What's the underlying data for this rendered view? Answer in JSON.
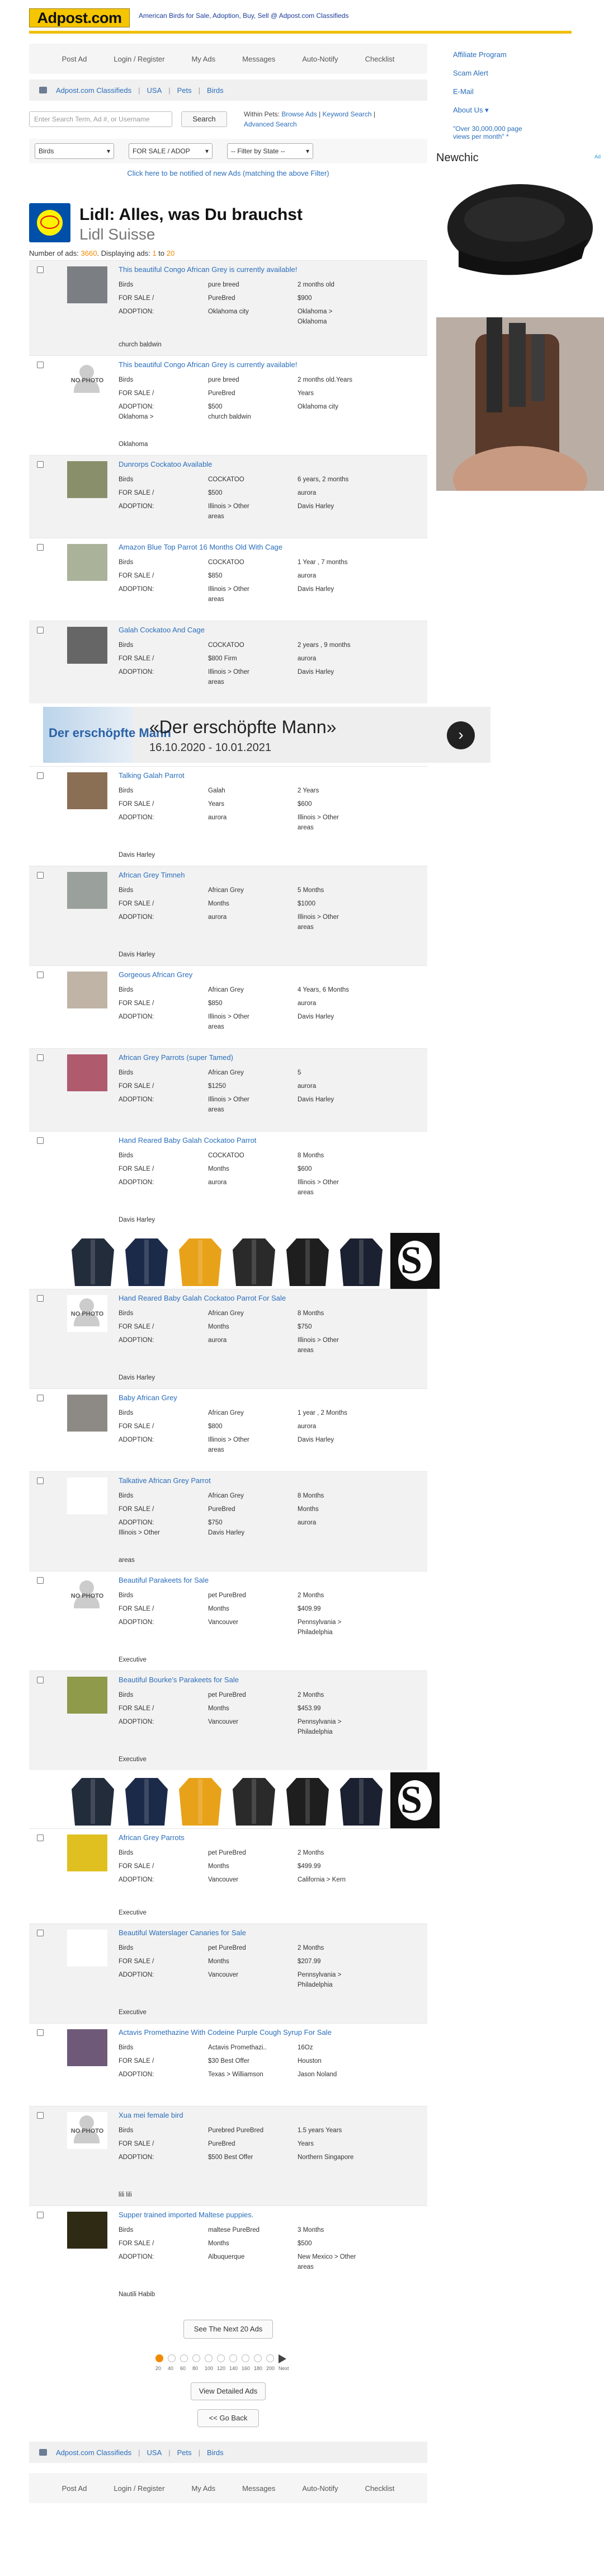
{
  "header": {
    "logo": "Adpost.com",
    "tagline": "American Birds for Sale, Adoption, Buy, Sell @ Adpost.com Classifieds"
  },
  "nav": [
    "Post Ad",
    "Login / Register",
    "My Ads",
    "Messages",
    "Auto-Notify",
    "Checklist"
  ],
  "breadcrumb": [
    "Adpost.com Classifieds",
    "USA",
    "Pets",
    "Birds"
  ],
  "search": {
    "placeholder": "Enter Search Term, Ad #, or Username",
    "button": "Search",
    "within_label": "Within Pets:",
    "browse_ads": "Browse Ads",
    "keyword_search": "Keyword Search",
    "advanced_search": "Advanced Search"
  },
  "filters": {
    "category": "Birds",
    "type": "FOR SALE / ADOP",
    "state": "-- Filter by State --"
  },
  "notify_link": "Click here to be notified of new Ads (matching the above Filter)",
  "ad_lidl": {
    "title": "Lidl: Alles, was Du brauchst",
    "subtitle": "Lidl Suisse"
  },
  "count": {
    "label": "Number of ads:",
    "total": "3660",
    "displaying": "Displaying ads:",
    "from": "1",
    "to": "to",
    "end": "20"
  },
  "listings": [
    {
      "title": "This beautiful Congo African Grey is currently available!",
      "photo": true,
      "cells": [
        "Birds",
        "pure breed",
        "2 months old",
        "FOR SALE /",
        "PureBred",
        "$900",
        "ADOPTION:",
        "Oklahoma city",
        "Oklahoma >"
      ],
      "extra": [
        "",
        "",
        "Oklahoma"
      ],
      "foot": "church baldwin"
    },
    {
      "title": "This beautiful Congo African Grey is currently available!",
      "photo": false,
      "cells": [
        "Birds",
        "pure breed",
        "2 months old.Years",
        "FOR SALE /",
        "PureBred",
        "Years",
        "ADOPTION:",
        "$500",
        "Oklahoma city"
      ],
      "extra": [
        "Oklahoma >",
        "church baldwin",
        ""
      ],
      "foot": "Oklahoma"
    },
    {
      "title": "Dunrorps Cockatoo Available",
      "photo": true,
      "cells": [
        "Birds",
        "COCKATOO",
        "6 years, 2 months",
        "FOR SALE /",
        "$500",
        "aurora",
        "ADOPTION:",
        "Illinois > Other",
        "Davis Harley"
      ],
      "extra": [
        "",
        "areas",
        ""
      ],
      "foot": ""
    },
    {
      "title": "Amazon Blue Top Parrot 16 Months Old With Cage",
      "photo": true,
      "cells": [
        "Birds",
        "COCKATOO",
        "1 Year , 7 months",
        "FOR SALE /",
        "$850",
        "aurora",
        "ADOPTION:",
        "Illinois > Other",
        "Davis Harley"
      ],
      "extra": [
        "",
        "areas",
        ""
      ],
      "foot": ""
    },
    {
      "title": "Galah Cockatoo And Cage",
      "photo": true,
      "cells": [
        "Birds",
        "COCKATOO",
        "2 years , 9 months",
        "FOR SALE /",
        "$800 Firm",
        "aurora",
        "ADOPTION:",
        "Illinois > Other",
        "Davis Harley"
      ],
      "extra": [
        "",
        "areas",
        ""
      ],
      "foot": ""
    },
    {
      "title": "Talking Galah Parrot",
      "photo": true,
      "cells": [
        "Birds",
        "Galah",
        "2 Years",
        "FOR SALE /",
        "Years",
        "$600",
        "ADOPTION:",
        "aurora",
        "Illinois > Other"
      ],
      "extra": [
        "",
        "",
        "areas"
      ],
      "foot": "Davis Harley"
    },
    {
      "title": "African Grey Timneh",
      "photo": true,
      "cells": [
        "Birds",
        "African Grey",
        "5 Months",
        "FOR SALE /",
        "Months",
        "$1000",
        "ADOPTION:",
        "aurora",
        "Illinois > Other"
      ],
      "extra": [
        "",
        "",
        "areas"
      ],
      "foot": "Davis Harley"
    },
    {
      "title": "Gorgeous African Grey",
      "photo": true,
      "cells": [
        "Birds",
        "African Grey",
        "4 Years, 6 Months",
        "FOR SALE /",
        "$850",
        "aurora",
        "ADOPTION:",
        "Illinois > Other",
        "Davis Harley"
      ],
      "extra": [
        "",
        "areas",
        ""
      ],
      "foot": ""
    },
    {
      "title": "African Grey Parrots (super Tamed)",
      "photo": true,
      "cells": [
        "Birds",
        "African Grey",
        "5",
        "FOR SALE /",
        "$1250",
        "aurora",
        "ADOPTION:",
        "Illinois > Other",
        "Davis Harley"
      ],
      "extra": [
        "",
        "areas",
        ""
      ],
      "foot": ""
    },
    {
      "title": "Hand Reared Baby Galah Cockatoo Parrot",
      "photo": true,
      "cells": [
        "Birds",
        "COCKATOO",
        "8 Months",
        "FOR SALE /",
        "Months",
        "$600",
        "ADOPTION:",
        "aurora",
        "Illinois > Other"
      ],
      "extra": [
        "",
        "",
        "areas"
      ],
      "foot": "Davis Harley"
    },
    {
      "title": "Hand Reared Baby Galah Cockatoo Parrot For Sale",
      "photo": false,
      "cells": [
        "Birds",
        "African Grey",
        "8 Months",
        "FOR SALE /",
        "Months",
        "$750",
        "ADOPTION:",
        "aurora",
        "Illinois > Other"
      ],
      "extra": [
        "",
        "",
        "areas"
      ],
      "foot": "Davis Harley"
    },
    {
      "title": "Baby African Grey",
      "photo": true,
      "cells": [
        "Birds",
        "African Grey",
        "1 year , 2 Months",
        "FOR SALE /",
        "$800",
        "aurora",
        "ADOPTION:",
        "Illinois > Other",
        "Davis Harley"
      ],
      "extra": [
        "",
        "areas",
        ""
      ],
      "foot": ""
    },
    {
      "title": "Talkative African Grey Parrot",
      "photo": true,
      "cells": [
        "Birds",
        "African Grey",
        "8 Months",
        "FOR SALE /",
        "PureBred",
        "Months",
        "ADOPTION:",
        "$750",
        "aurora"
      ],
      "extra": [
        "Illinois > Other",
        "Davis Harley",
        ""
      ],
      "foot": "areas"
    },
    {
      "title": "Beautiful Parakeets for Sale",
      "photo": false,
      "cells": [
        "Birds",
        "pet PureBred",
        "2 Months",
        "FOR SALE /",
        "Months",
        "$409.99",
        "ADOPTION:",
        "Vancouver",
        "Pennsylvania >"
      ],
      "extra": [
        "",
        "",
        "Philadelphia"
      ],
      "foot": "Executive"
    },
    {
      "title": "Beautiful Bourke's Parakeets for Sale",
      "photo": true,
      "cells": [
        "Birds",
        "pet PureBred",
        "2 Months",
        "FOR SALE /",
        "Months",
        "$453.99",
        "ADOPTION:",
        "Vancouver",
        "Pennsylvania >"
      ],
      "extra": [
        "",
        "",
        "Philadelphia"
      ],
      "foot": "Executive"
    },
    {
      "title": "African Grey Parrots",
      "photo": true,
      "cells": [
        "Birds",
        "pet PureBred",
        "2 Months",
        "FOR SALE /",
        "Months",
        "$499.99",
        "ADOPTION:",
        "Vancouver",
        "California > Kern"
      ],
      "extra": [
        "",
        "",
        ""
      ],
      "foot": "Executive"
    },
    {
      "title": "Beautiful Waterslager Canaries for Sale",
      "photo": true,
      "cells": [
        "Birds",
        "pet PureBred",
        "2 Months",
        "FOR SALE /",
        "Months",
        "$207.99",
        "ADOPTION:",
        "Vancouver",
        "Pennsylvania >"
      ],
      "extra": [
        "",
        "",
        "Philadelphia"
      ],
      "foot": "Executive"
    },
    {
      "title": "Actavis Promethazine With Codeine Purple Cough Syrup For Sale",
      "photo": true,
      "cells": [
        "Birds",
        "Actavis Promethazi..",
        "16Oz",
        "FOR SALE /",
        "$30 Best Offer",
        "Houston",
        "ADOPTION:",
        "Texas > Williamson",
        "Jason Noland"
      ],
      "extra": [
        "",
        "",
        ""
      ],
      "foot": ""
    },
    {
      "title": "Xua mei female bird",
      "photo": false,
      "cells": [
        "Birds",
        "Purebred PureBred",
        "1.5 years Years",
        "FOR SALE /",
        "PureBred",
        "Years",
        "ADOPTION:",
        "$500 Best Offer",
        "Northern Singapore"
      ],
      "extra": [
        "",
        "",
        ""
      ],
      "foot": "lili lili"
    },
    {
      "title": "Supper trained imported Maltese puppies.",
      "photo": true,
      "cells": [
        "Birds",
        "maltese PureBred",
        "3 Months",
        "FOR SALE /",
        "Months",
        "$500",
        "ADOPTION:",
        "Albuquerque",
        "New Mexico > Other"
      ],
      "extra": [
        "",
        "",
        "areas"
      ],
      "foot": "Nautili Habib"
    }
  ],
  "banner_ad": {
    "title": "«Der erschöpfte Mann»",
    "dates": "16.10.2020 - 10.01.2021",
    "brand": "Der erschöpfte Mann",
    "arrow": "›"
  },
  "next_button": "See The Next 20 Ads",
  "pager_numbers": [
    "20",
    "40",
    "60",
    "80",
    "100",
    "120",
    "140",
    "160",
    "180",
    "200",
    "Next"
  ],
  "view_detailed": "View Detailed Ads",
  "go_back": "<< Go Back",
  "sidebar": {
    "links": [
      "Affiliate Program",
      "Scam Alert",
      "E-Mail",
      "About Us"
    ],
    "about_caret": "▾",
    "quote": "\"Over 30,000,000 page views per month\" *",
    "ad_brand": "Newchic",
    "ad_badge": "Ad"
  },
  "colors": {
    "link": "#2a6ebb",
    "logo_bg": "#f5c500",
    "accent": "#f08a00"
  }
}
